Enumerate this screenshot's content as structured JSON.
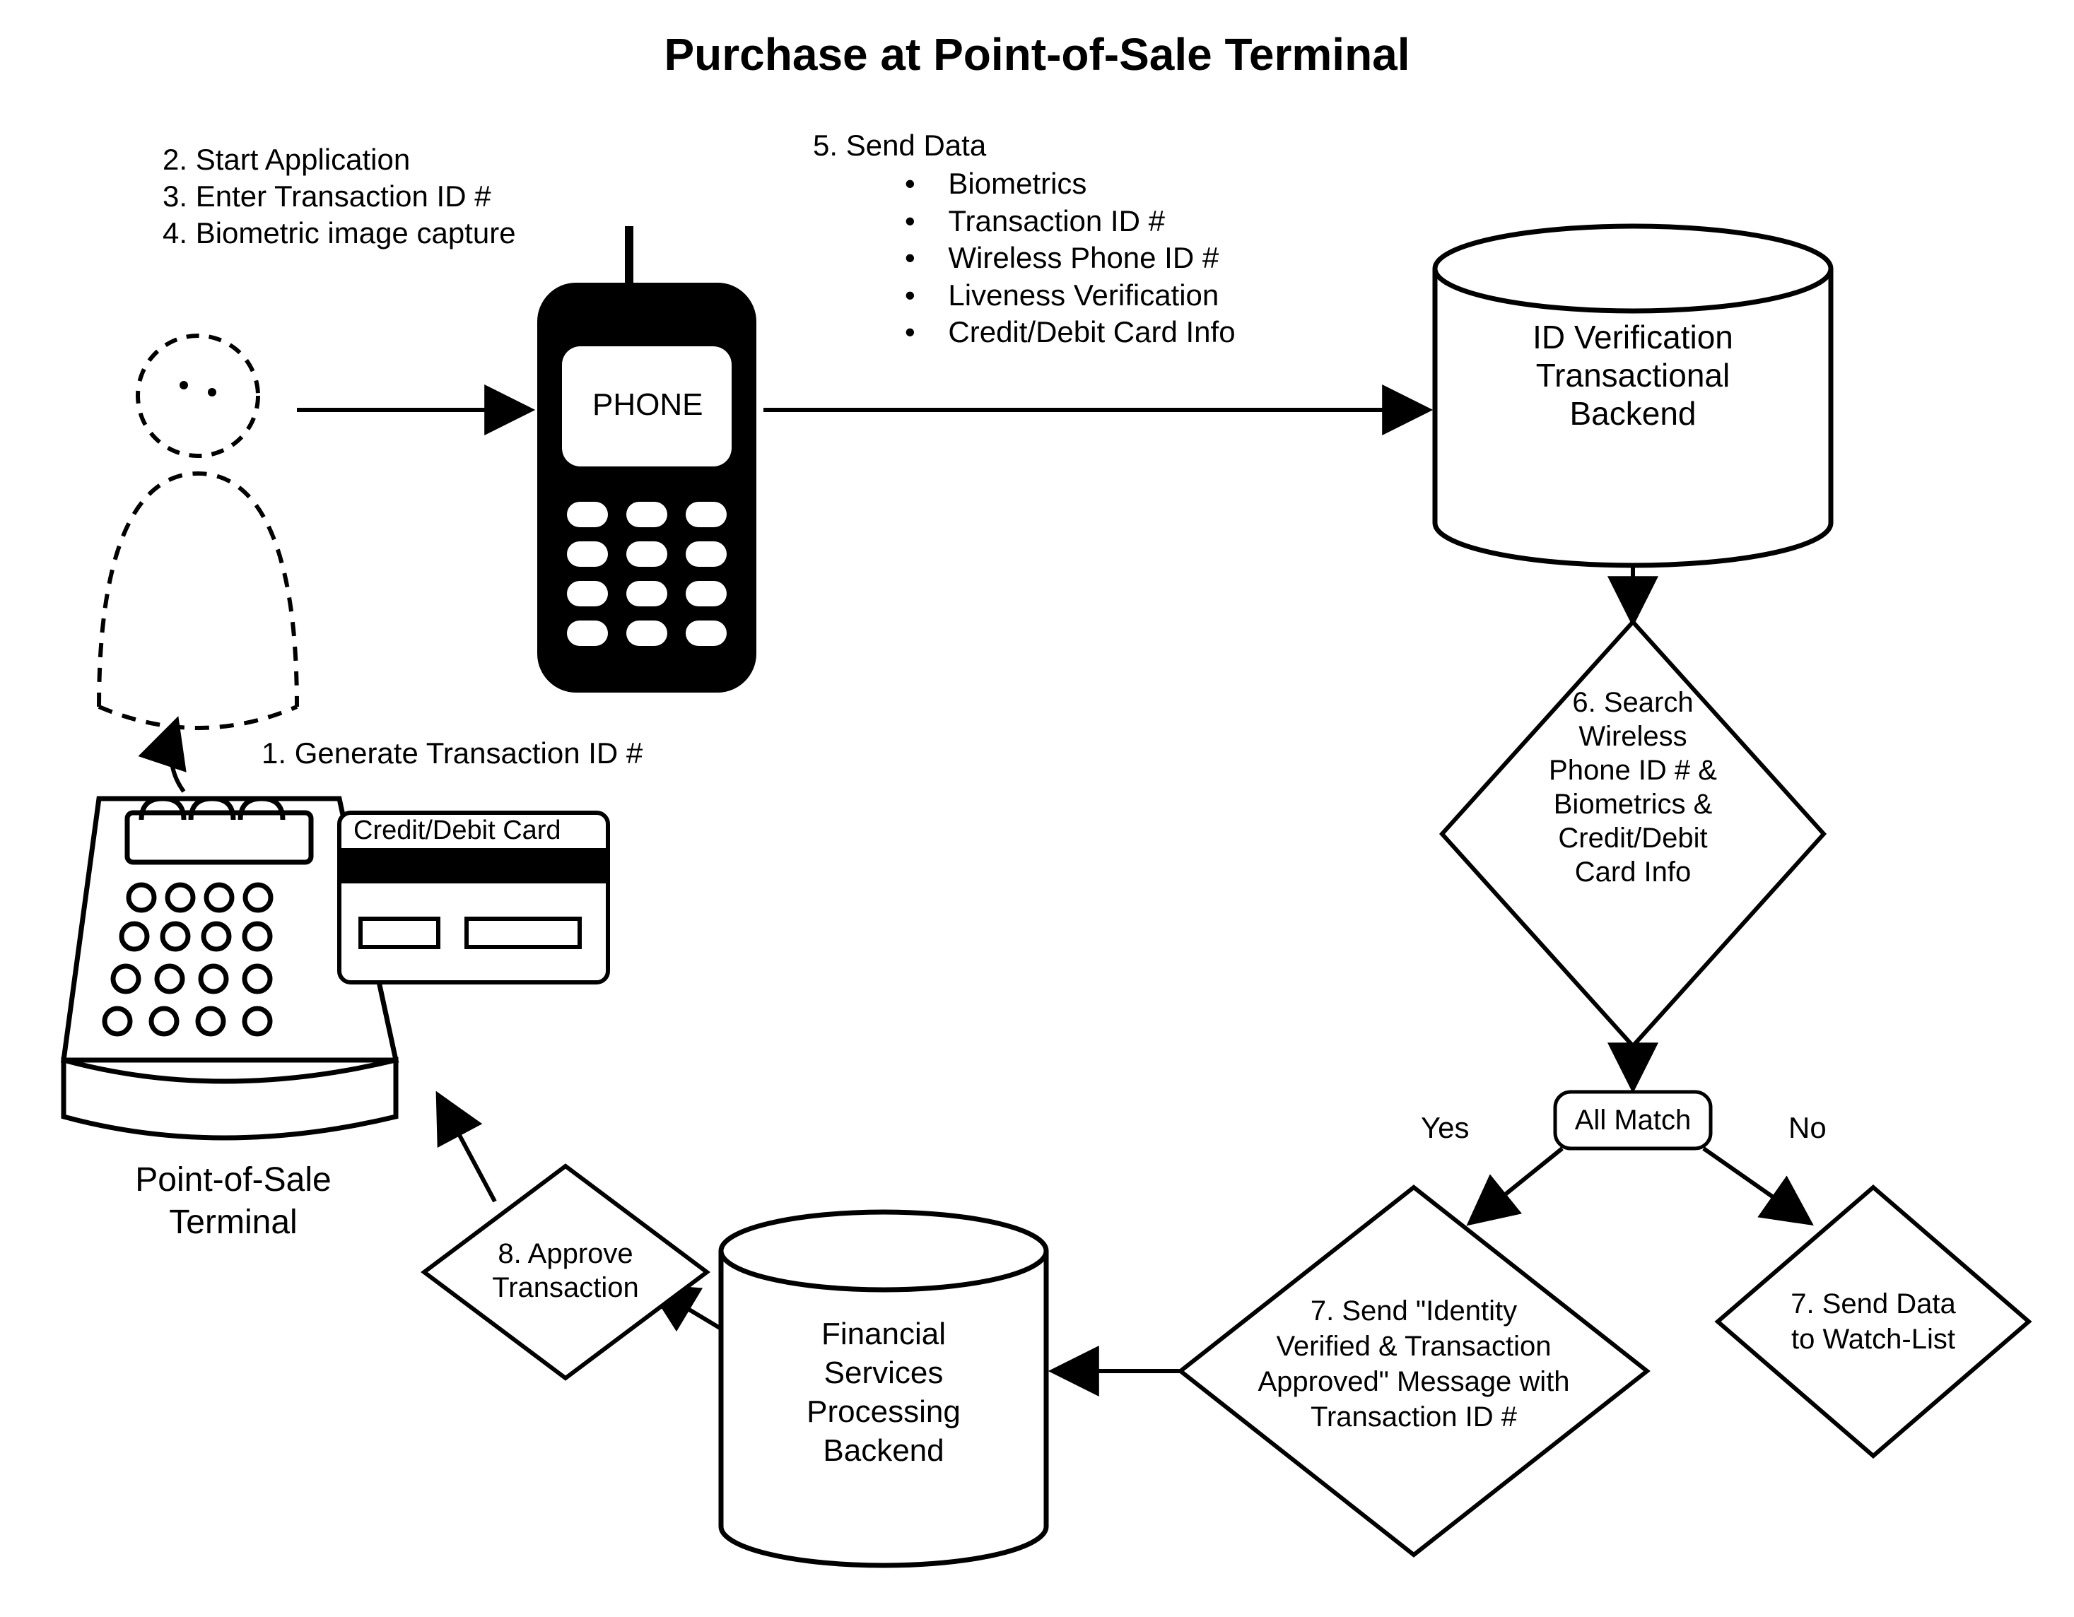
{
  "title": "Purchase at Point-of-Sale Terminal",
  "steps234": {
    "s2": "2.    Start Application",
    "s3": "3.    Enter Transaction ID #",
    "s4": "4.    Biometric image capture"
  },
  "step5": {
    "header": "5.    Send Data",
    "b1": "Biometrics",
    "b2": "Transaction ID #",
    "b3": "Wireless Phone ID #",
    "b4": "Liveness Verification",
    "b5": "Credit/Debit Card Info"
  },
  "phone_label": "PHONE",
  "step1": "1. Generate Transaction ID #",
  "card_label": "Credit/Debit Card",
  "pos_label_l1": "Point-of-Sale",
  "pos_label_l2": "Terminal",
  "cyl_id_l1": "ID Verification",
  "cyl_id_l2": "Transactional",
  "cyl_id_l3": "Backend",
  "d6_l1": "6. Search",
  "d6_l2": "Wireless",
  "d6_l3": "Phone ID # &",
  "d6_l4": "Biometrics &",
  "d6_l5": "Credit/Debit",
  "d6_l6": "Card Info",
  "all_match": "All Match",
  "yes": "Yes",
  "no": "No",
  "d7yes_l1": "7. Send \"Identity",
  "d7yes_l2": "Verified & Transaction",
  "d7yes_l3": "Approved\" Message with",
  "d7yes_l4": "Transaction ID #",
  "d7no_l1": "7. Send Data",
  "d7no_l2": "to Watch-List",
  "cyl_fin_l1": "Financial",
  "cyl_fin_l2": "Services",
  "cyl_fin_l3": "Processing",
  "cyl_fin_l4": "Backend",
  "d8_l1": "8. Approve",
  "d8_l2": "Transaction"
}
